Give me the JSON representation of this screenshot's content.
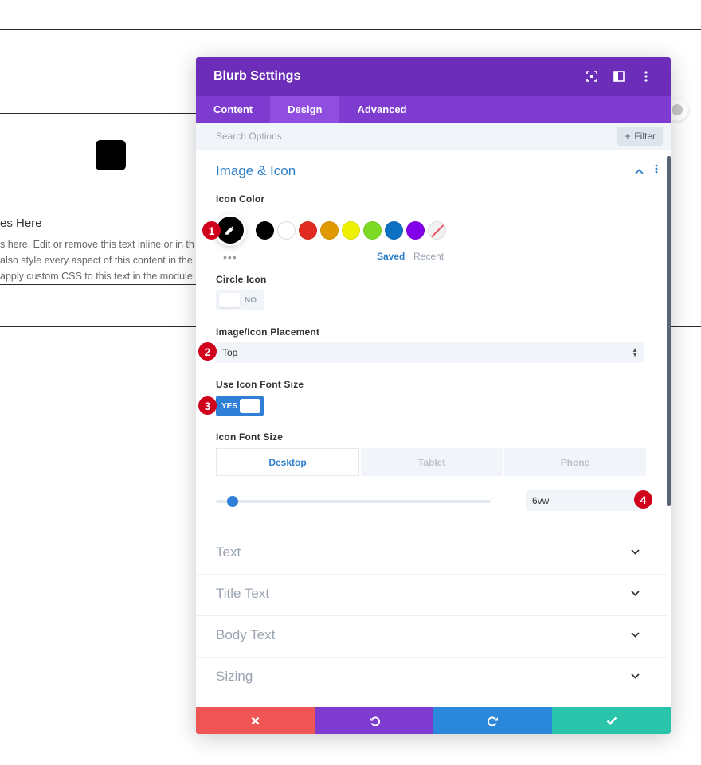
{
  "background": {
    "title": "es Here",
    "lines": [
      "s here. Edit or remove this text inline or in th",
      "also style every aspect of this content in the",
      " apply custom CSS to this text in the module"
    ]
  },
  "modal": {
    "title": "Blurb Settings",
    "header_icons": [
      "fullscreen-icon",
      "sidebar-layout-icon",
      "more-vertical-icon"
    ],
    "tabs": [
      {
        "label": "Content",
        "active": false
      },
      {
        "label": "Design",
        "active": true
      },
      {
        "label": "Advanced",
        "active": false
      }
    ],
    "search_placeholder": "Search Options",
    "filter_label": "Filter",
    "section": {
      "title": "Image & Icon",
      "icon_color_label": "Icon Color",
      "selected_color": "#000000",
      "swatches": [
        "#000000",
        "#ffffff",
        "#e02b20",
        "#e09900",
        "#edf000",
        "#7cda24",
        "#0c71c3",
        "#8300e9",
        "clear"
      ],
      "more_label": "•••",
      "saved_label": "Saved",
      "recent_label": "Recent",
      "circle_icon_label": "Circle Icon",
      "circle_icon_value": "NO",
      "placement_label": "Image/Icon Placement",
      "placement_value": "Top",
      "use_font_size_label": "Use Icon Font Size",
      "use_font_size_value": "YES",
      "font_size_label": "Icon Font Size",
      "device_tabs": [
        {
          "label": "Desktop",
          "active": true
        },
        {
          "label": "Tablet",
          "active": false
        },
        {
          "label": "Phone",
          "active": false
        }
      ],
      "font_size_value": "6vw"
    },
    "collapsed_sections": [
      "Text",
      "Title Text",
      "Body Text",
      "Sizing"
    ],
    "footer": {
      "cancel_color": "#ef5555",
      "undo_color": "#7e3bd0",
      "redo_color": "#2b87da",
      "save_color": "#29c4a9"
    }
  },
  "markers": [
    "1",
    "2",
    "3",
    "4"
  ]
}
